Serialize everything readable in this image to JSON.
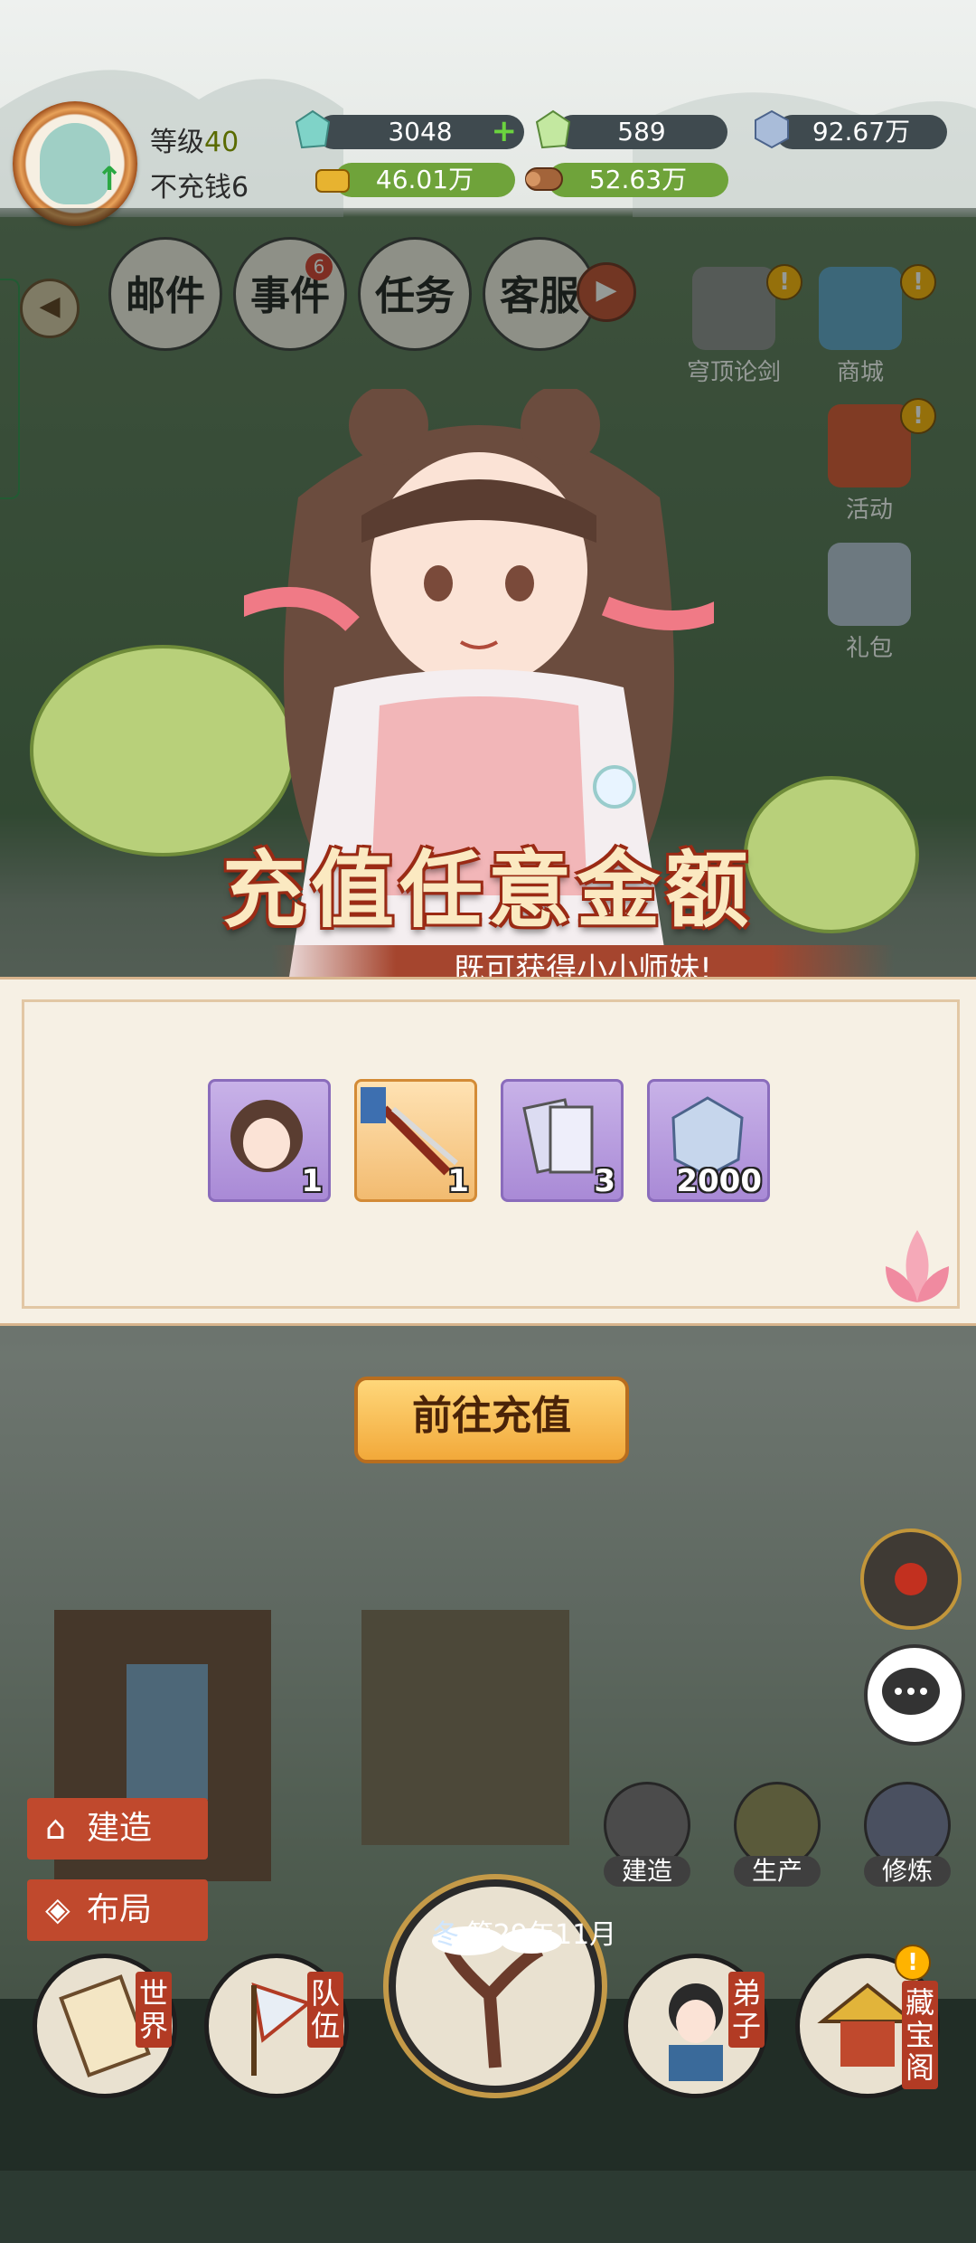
{
  "player": {
    "level_label": "等级",
    "level": "40",
    "status": "不充钱6"
  },
  "resources": {
    "jade": "3048",
    "crystal": "589",
    "diamond": "92.67万",
    "gold": "46.01万",
    "wood": "52.63万"
  },
  "menu_tabs": [
    {
      "label": "邮件"
    },
    {
      "label": "事件",
      "badge": "6"
    },
    {
      "label": "任务"
    },
    {
      "label": "客服"
    }
  ],
  "side_buttons": [
    {
      "label": "穹顶论剑",
      "icon": "crossed-swords-icon"
    },
    {
      "label": "商城",
      "icon": "shop-icon"
    },
    {
      "label": "活动",
      "icon": "lantern-icon"
    },
    {
      "label": "礼包",
      "icon": "gift-icon"
    }
  ],
  "popup": {
    "title": "充值任意金额",
    "subtitle": "既可获得小小师妹!",
    "rewards": [
      {
        "icon": "girl-avatar-icon",
        "count": "1"
      },
      {
        "icon": "golden-sword-icon",
        "count": "1"
      },
      {
        "icon": "scroll-cards-icon",
        "count": "3"
      },
      {
        "icon": "diamond-icon",
        "count": "2000"
      }
    ],
    "button_label": "前往充值"
  },
  "left_actions": {
    "build": "建造",
    "layout": "布局"
  },
  "small_buttons": [
    {
      "label": "建造",
      "icon": "hammer-icon"
    },
    {
      "label": "生产",
      "icon": "wheat-icon"
    },
    {
      "label": "修炼",
      "icon": "cultivate-icon"
    }
  ],
  "bottom_nav": [
    {
      "label": "世界",
      "icon": "scroll-map-icon"
    },
    {
      "label": "队伍",
      "icon": "banner-icon"
    },
    {
      "label": "弟子",
      "icon": "disciple-icon"
    },
    {
      "label": "藏宝阁",
      "icon": "treasure-pavilion-icon"
    }
  ],
  "season": {
    "season": "冬",
    "date": "第29年11月"
  },
  "colors": {
    "accent_red": "#b23b24",
    "title_gold": "#fbe9c1",
    "button_orange": "#f2a93a",
    "item_purple": "#a98ad6"
  }
}
